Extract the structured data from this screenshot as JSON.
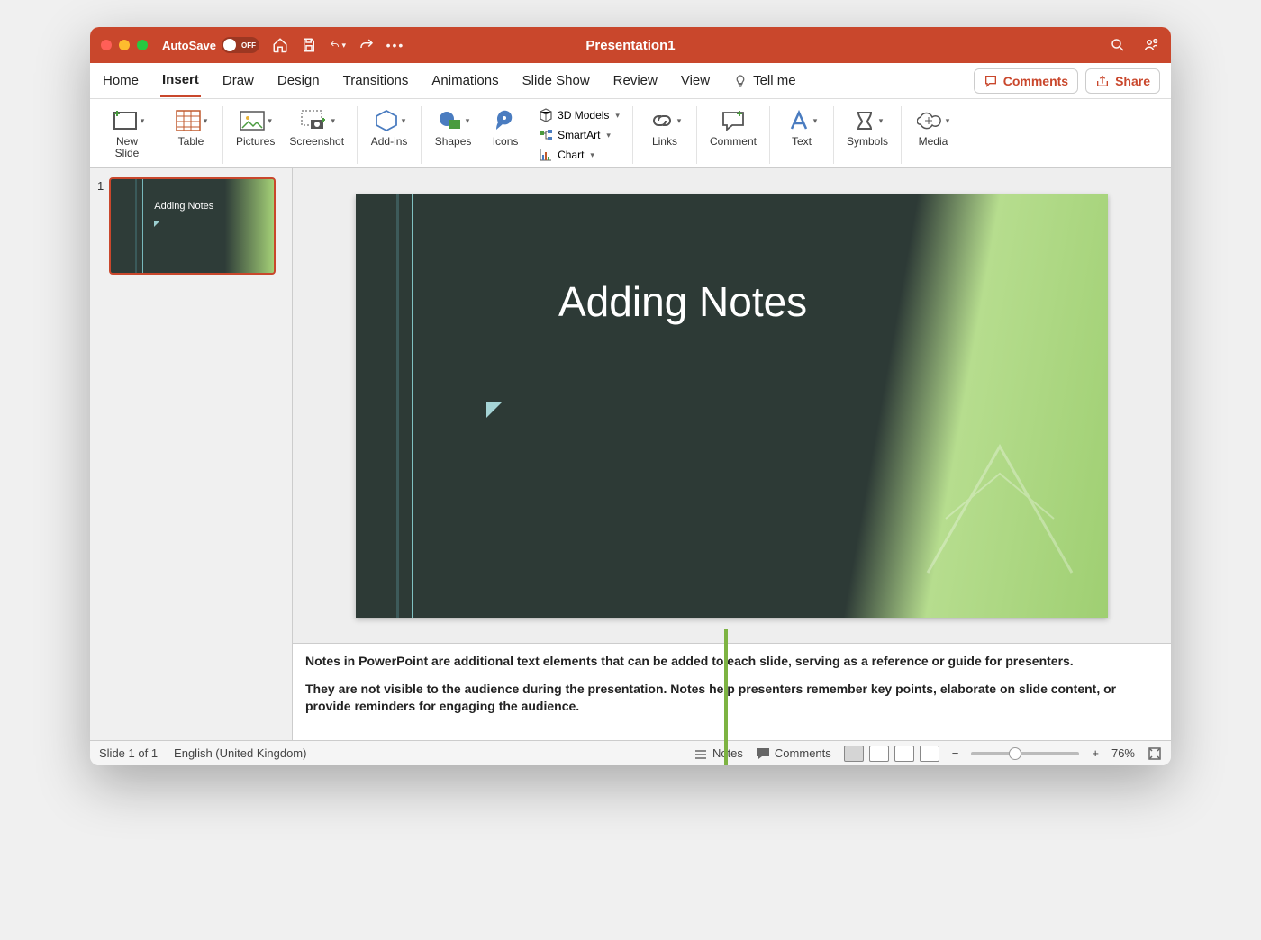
{
  "titlebar": {
    "autosave_label": "AutoSave",
    "autosave_state": "OFF",
    "doc_title": "Presentation1"
  },
  "tabs": {
    "home": "Home",
    "insert": "Insert",
    "draw": "Draw",
    "design": "Design",
    "transitions": "Transitions",
    "animations": "Animations",
    "slideshow": "Slide Show",
    "review": "Review",
    "view": "View",
    "tellme": "Tell me",
    "comments_btn": "Comments",
    "share_btn": "Share"
  },
  "ribbon": {
    "new_slide": "New\nSlide",
    "table": "Table",
    "pictures": "Pictures",
    "screenshot": "Screenshot",
    "addins": "Add-ins",
    "shapes": "Shapes",
    "icons": "Icons",
    "models3d": "3D Models",
    "smartart": "SmartArt",
    "chart": "Chart",
    "links": "Links",
    "comment": "Comment",
    "text": "Text",
    "symbols": "Symbols",
    "media": "Media"
  },
  "thumbs": {
    "num1": "1",
    "title1": "Adding Notes"
  },
  "slide": {
    "title": "Adding Notes"
  },
  "notes": {
    "p1": "Notes in PowerPoint are additional text elements that can be added to each slide, serving as a reference or guide for presenters.",
    "p2": "They are not visible to the audience during the presentation. Notes help presenters remember key points, elaborate on slide content, or provide reminders for engaging the audience."
  },
  "status": {
    "slide_of": "Slide 1 of 1",
    "lang": "English (United Kingdom)",
    "notes": "Notes",
    "comments": "Comments",
    "zoom": "76%"
  }
}
